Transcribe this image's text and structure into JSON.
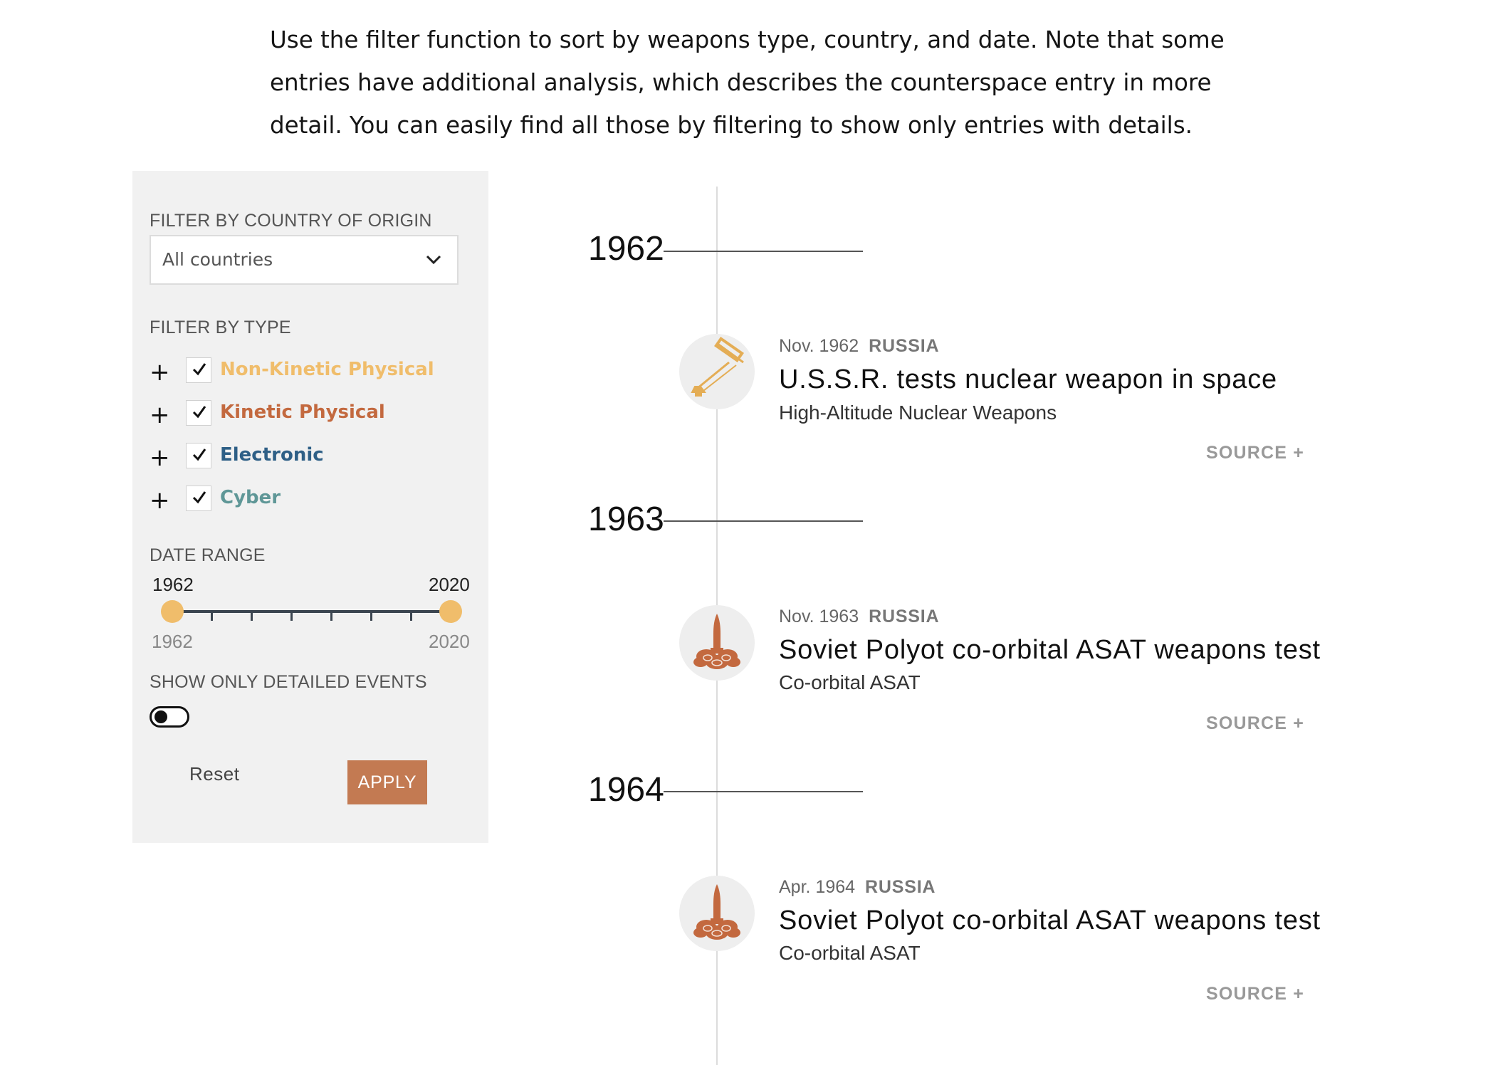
{
  "intro": "Use the filter function to sort by weapons type, country, and date. Note that some entries have additional analysis, which describes the counterspace entry in more detail. You can easily find all those by filtering to show only entries with details.",
  "filters": {
    "country_label": "FILTER BY COUNTRY OF ORIGIN",
    "country_value": "All countries",
    "type_label": "FILTER BY TYPE",
    "types": [
      {
        "label": "Non-Kinetic Physical",
        "color": "#f0bd6b",
        "checked": true
      },
      {
        "label": "Kinetic Physical",
        "color": "#c3693f",
        "checked": true
      },
      {
        "label": "Electronic",
        "color": "#2e5f86",
        "checked": true
      },
      {
        "label": "Cyber",
        "color": "#5f9797",
        "checked": true
      }
    ],
    "expand_symbol": "+",
    "date_label": "DATE RANGE",
    "range_start": "1962",
    "range_end": "2020",
    "range_min": "1962",
    "range_max": "2020",
    "detailed_label": "SHOW ONLY DETAILED EVENTS",
    "detailed_on": false,
    "reset": "Reset",
    "apply": "APPLY"
  },
  "timeline": {
    "years": [
      "1962",
      "1963",
      "1964"
    ],
    "events": [
      {
        "date": "Nov. 1962",
        "country": "RUSSIA",
        "title": "U.S.S.R. tests nuclear weapon in space",
        "type": "High-Altitude Nuclear Weapons",
        "icon": "satellite-beam-icon",
        "source": "SOURCE +"
      },
      {
        "date": "Nov. 1963",
        "country": "RUSSIA",
        "title": "Soviet Polyot co-orbital ASAT weapons test",
        "type": "Co-orbital ASAT",
        "icon": "rocket-launch-icon",
        "source": "SOURCE +"
      },
      {
        "date": "Apr. 1964",
        "country": "RUSSIA",
        "title": "Soviet Polyot co-orbital ASAT weapons test",
        "type": "Co-orbital ASAT",
        "icon": "rocket-launch-icon",
        "source": "SOURCE +"
      }
    ]
  }
}
